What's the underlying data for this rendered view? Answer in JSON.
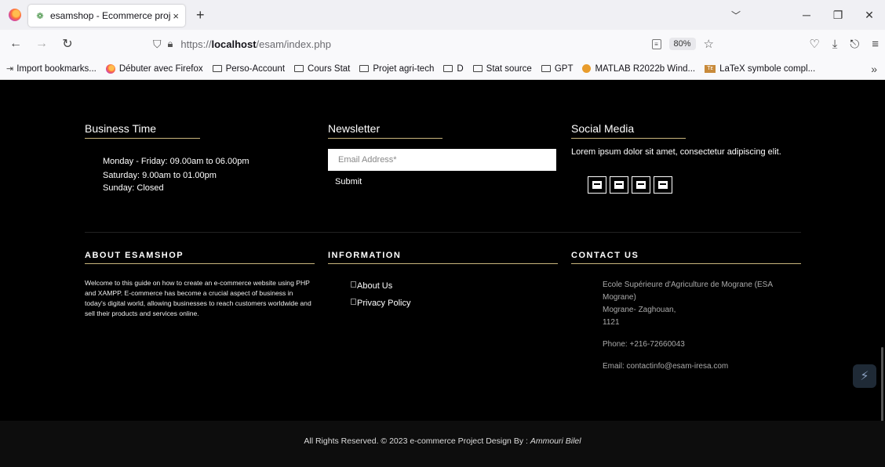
{
  "browser": {
    "tab_title": "esamshop - Ecommerce project",
    "tab_close": "×",
    "new_tab": "+",
    "url_proto": "https://",
    "url_host": "localhost",
    "url_path": "/esam/index.php",
    "zoom": "80%",
    "bookmarks": [
      {
        "label": "Import bookmarks...",
        "icon": "import-icon"
      },
      {
        "label": "Débuter avec Firefox",
        "icon": "firefox-icon"
      },
      {
        "label": "Perso-Account",
        "icon": "folder-icon"
      },
      {
        "label": "Cours Stat",
        "icon": "folder-icon"
      },
      {
        "label": "Projet agri-tech",
        "icon": "folder-icon"
      },
      {
        "label": "D",
        "icon": "folder-icon"
      },
      {
        "label": "Stat source",
        "icon": "folder-icon"
      },
      {
        "label": "GPT",
        "icon": "folder-icon"
      },
      {
        "label": "MATLAB R2022b Wind...",
        "icon": "matlab-icon"
      },
      {
        "label": "LaTeX symbole compl...",
        "icon": "latex-icon"
      }
    ]
  },
  "footer": {
    "business": {
      "title": "Business Time",
      "lines": [
        "Monday - Friday: 09.00am to 06.00pm",
        "Saturday: 9.00am to 01.00pm",
        "Sunday: Closed"
      ]
    },
    "newsletter": {
      "title": "Newsletter",
      "placeholder": "Email Address*",
      "submit": "Submit"
    },
    "social": {
      "title": "Social Media",
      "text": "Lorem ipsum dolor sit amet, consectetur adipiscing elit."
    },
    "about": {
      "title": "ABOUT ESAMSHOP",
      "text": "Welcome to this guide on how to create an e-commerce website using PHP and XAMPP. E-commerce has become a crucial aspect of business in today's digital world, allowing businesses to reach customers worldwide and sell their products and services online."
    },
    "information": {
      "title": "INFORMATION",
      "links": [
        "About Us",
        "Privacy Policy"
      ]
    },
    "contact": {
      "title": "CONTACT US",
      "address1": "Ecole Supérieure d'Agriculture de Mograne (ESA Mograne)",
      "address2": "Mograne- Zaghouan,",
      "postcode": "1121",
      "phone": "Phone: +216-72660043",
      "email": "Email: contactinfo@esam-iresa.com"
    },
    "copyright_prefix": "All Rights Reserved. © 2023 e-commerce Project Design By : ",
    "copyright_author": "Ammouri Bilel"
  },
  "colors": {
    "accent_underline": "#c9b67d",
    "page_bg": "#000000"
  }
}
